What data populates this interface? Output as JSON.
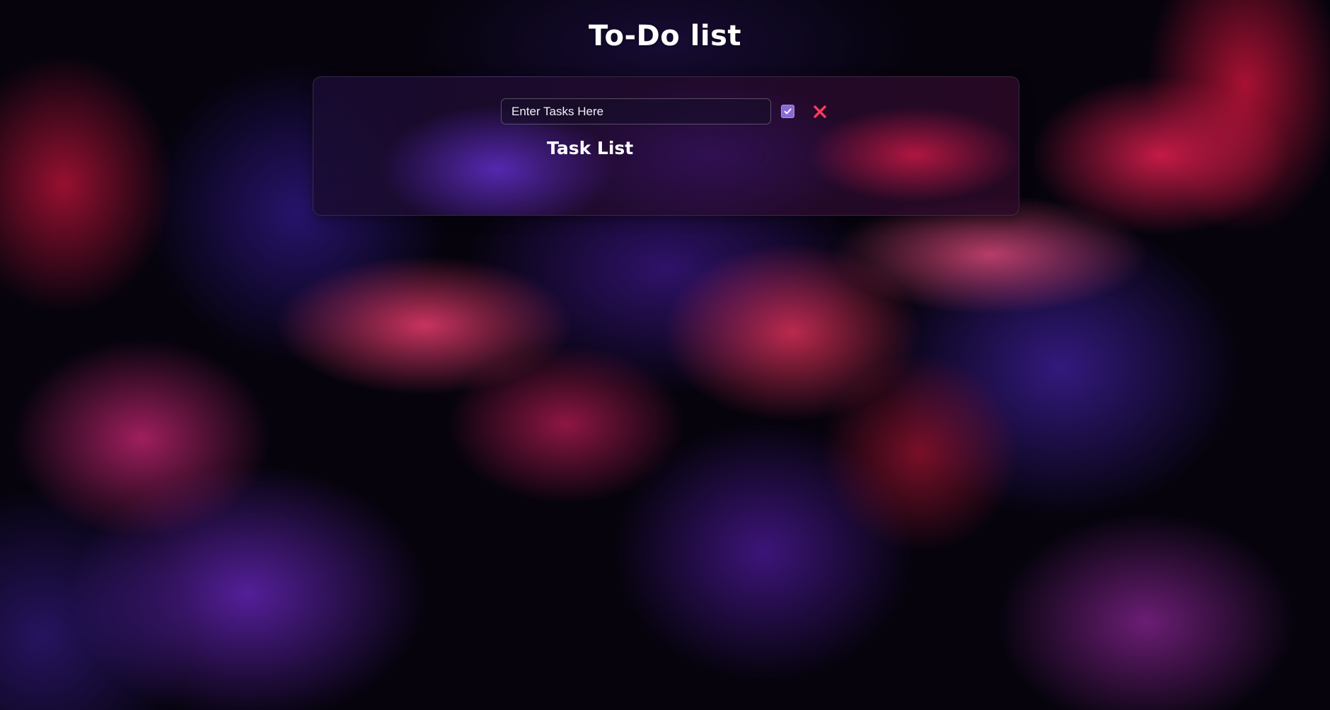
{
  "page": {
    "title": "To-Do list"
  },
  "task_form": {
    "input_placeholder": "Enter Tasks Here",
    "input_value": "",
    "check_icon": "checkbox-check-icon",
    "close_icon": "close-x-icon"
  },
  "task_list": {
    "heading": "Task List",
    "items": []
  },
  "colors": {
    "accent_check": "#8a6ad8",
    "accent_close": "#ff3b5c",
    "text": "#ffffff"
  }
}
